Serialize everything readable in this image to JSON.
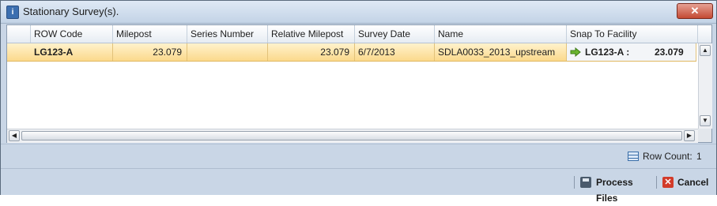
{
  "window": {
    "title": "Stationary Survey(s).",
    "close_glyph": "✕"
  },
  "grid": {
    "columns": [
      "ROW Code",
      "Milepost",
      "Series Number",
      "Relative Milepost",
      "Survey Date",
      "Name",
      "Snap To Facility"
    ],
    "rows": [
      {
        "row_code": "LG123-A",
        "milepost": "23.079",
        "series_number": "",
        "relative_milepost": "23.079",
        "survey_date": "6/7/2013",
        "name": "SDLA0033_2013_upstream",
        "snap_code": "LG123-A :",
        "snap_value": "23.079"
      }
    ],
    "scroll": {
      "up": "▲",
      "down": "▼",
      "left": "◀",
      "right": "▶"
    }
  },
  "status": {
    "row_count_label": "Row Count:",
    "row_count_value": "1"
  },
  "footer": {
    "process_label": "Process Files",
    "cancel_label": "Cancel",
    "cancel_glyph": "✕"
  },
  "colors": {
    "selected_row": "#fbd98c",
    "chrome": "#c9d6e6",
    "snap_arrow": "#6bb52f"
  }
}
